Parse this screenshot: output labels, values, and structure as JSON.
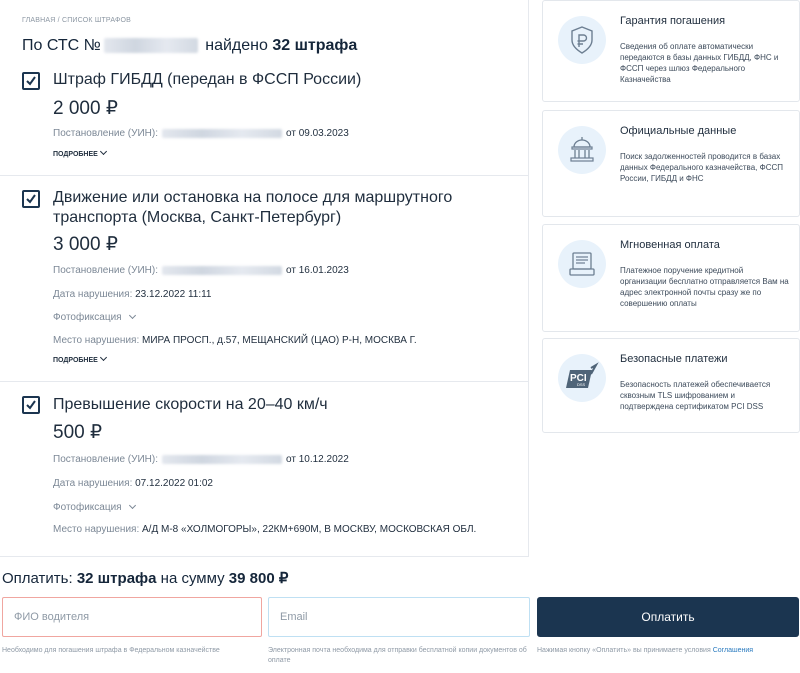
{
  "breadcrumb": "ГЛАВНАЯ / СПИСОК ШТРАФОВ",
  "headline": {
    "prefix": "По СТС №",
    "middle": " найдено ",
    "count": "32 штрафа"
  },
  "fines": [
    {
      "title": "Штраф ГИБДД (передан в ФССП России)",
      "amount": "2 000 ₽",
      "resolution_label": "Постановление (УИН):",
      "resolution_date": "от 09.03.2023",
      "more": "ПОДРОБНЕЕ"
    },
    {
      "title": "Движение или остановка на полосе для маршрутного транспорта (Москва, Санкт-Петербург)",
      "amount": "3 000 ₽",
      "resolution_label": "Постановление (УИН):",
      "resolution_date": "от 16.01.2023",
      "violation_label": "Дата нарушения:",
      "violation_date": "23.12.2022 11:11",
      "photo": "Фотофиксация",
      "place_label": "Место нарушения:",
      "place": "МИРА ПРОСП., д.57, МЕЩАНСКИЙ (ЦАО) Р-Н, МОСКВА Г.",
      "more": "ПОДРОБНЕЕ"
    },
    {
      "title": "Превышение скорости на 20–40 км/ч",
      "amount": "500 ₽",
      "resolution_label": "Постановление (УИН):",
      "resolution_date": "от 10.12.2022",
      "violation_label": "Дата нарушения:",
      "violation_date": "07.12.2022 01:02",
      "photo": "Фотофиксация",
      "place_label": "Место нарушения:",
      "place": "А/Д М-8 «ХОЛМОГОРЫ», 22КМ+690М, В МОСКВУ, МОСКОВСКАЯ ОБЛ."
    }
  ],
  "cards": [
    {
      "icon": "shield-ruble-icon",
      "title": "Гарантия погашения",
      "text": "Сведения об оплате автоматически передаются в базы данных ГИБДД, ФНС и ФССП через шлюз Федерального Казначейства"
    },
    {
      "icon": "government-building-icon",
      "title": "Официальные данные",
      "text": "Поиск задолженностей проводится в базах данных Федерального казначейства, ФССП России, ГИБДД и ФНС"
    },
    {
      "icon": "payment-terminal-icon",
      "title": "Мгновенная оплата",
      "text": "Платежное поручение кредитной организации бесплатно отправляется Вам на адрес электронной почты сразу же по совершению оплаты"
    },
    {
      "icon": "pci-dss-icon",
      "title": "Безопасные платежи",
      "text": "Безопасность платежей обеспечивается сквозным TLS шифрованием и подтверждена сертификатом PCI DSS"
    }
  ],
  "pay": {
    "prefix": "Оплатить: ",
    "count": "32 штрафа",
    "middle": " на сумму ",
    "sum": "39 800 ₽",
    "name_placeholder": "ФИО водителя",
    "email_placeholder": "Email",
    "button": "Оплатить",
    "name_hint": "Необходимо для погашения штрафа в Федеральном казначействе",
    "email_hint": "Электронная почта необходима для отправки бесплатной копии документов об оплате",
    "terms_hint": "Нажимая кнопку «Оплатить» вы принимаете условия ",
    "terms_link": "Соглашения"
  },
  "colors": {
    "primary": "#1b3550",
    "accent_link": "#2a7bbf",
    "error_border": "#f0a6a0",
    "icon_bg": "#e8f2fb"
  }
}
